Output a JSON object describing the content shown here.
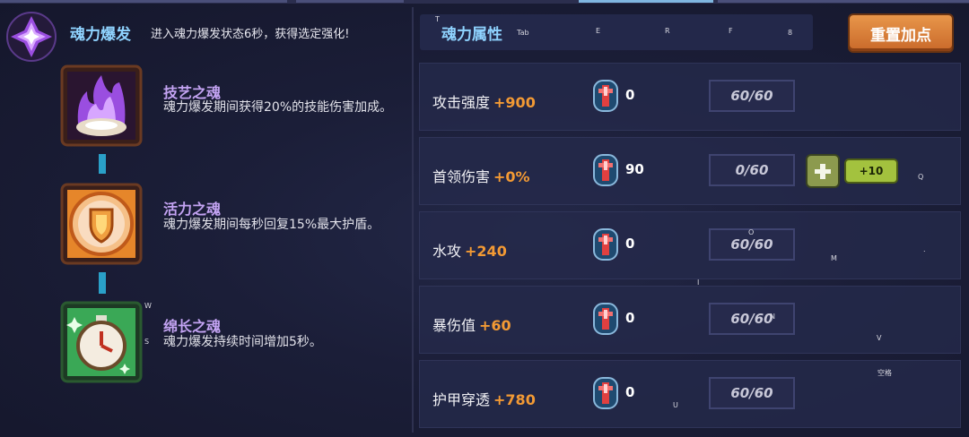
{
  "soul_burst": {
    "title": "魂力爆发",
    "description": "进入魂力爆发状态6秒，获得选定强化!"
  },
  "skills": [
    {
      "name": "技艺之魂",
      "description": "魂力爆发期间获得20%的技能伤害加成。",
      "icon": "purple-flame-icon",
      "color": "#b05cf0"
    },
    {
      "name": "活力之魂",
      "description": "魂力爆发期间每秒回复15%最大护盾。",
      "icon": "orange-shield-icon",
      "color": "#f0902c"
    },
    {
      "name": "绵长之魂",
      "description": "魂力爆发持续时间增加5秒。",
      "icon": "green-clock-icon",
      "color": "#46c468"
    }
  ],
  "attributes_panel": {
    "title": "魂力属性",
    "tab_hint": "Tab",
    "key_hints": [
      "E",
      "R",
      "F",
      "8"
    ],
    "reset_button": "重置加点"
  },
  "stats": [
    {
      "name": "攻击强度",
      "bonus": "+900",
      "gems": "0",
      "points": "60/60"
    },
    {
      "name": "首领伤害",
      "bonus": "+0%",
      "gems": "90",
      "points": "0/60",
      "plus_label": "+",
      "plus10_label": "+10"
    },
    {
      "name": "水攻",
      "bonus": "+240",
      "gems": "0",
      "points": "60/60"
    },
    {
      "name": "暴伤值",
      "bonus": "+60",
      "gems": "0",
      "points": "60/60"
    },
    {
      "name": "护甲穿透",
      "bonus": "+780",
      "gems": "0",
      "points": "60/60"
    }
  ],
  "overlay_hints": {
    "t": "T",
    "q": "Q",
    "o": "O",
    "m": "M",
    "comma": ".",
    "i": "I",
    "w": "W",
    "s": "S",
    "n": "N",
    "v": "V",
    "space": "空格",
    "u": "U"
  },
  "colors": {
    "title_blue": "#8fd3ff",
    "bonus_orange": "#f39a34",
    "skill_name_purple": "#c3a3f2",
    "reset_orange": "#d97a35",
    "plus_green": "#a3c23e"
  }
}
